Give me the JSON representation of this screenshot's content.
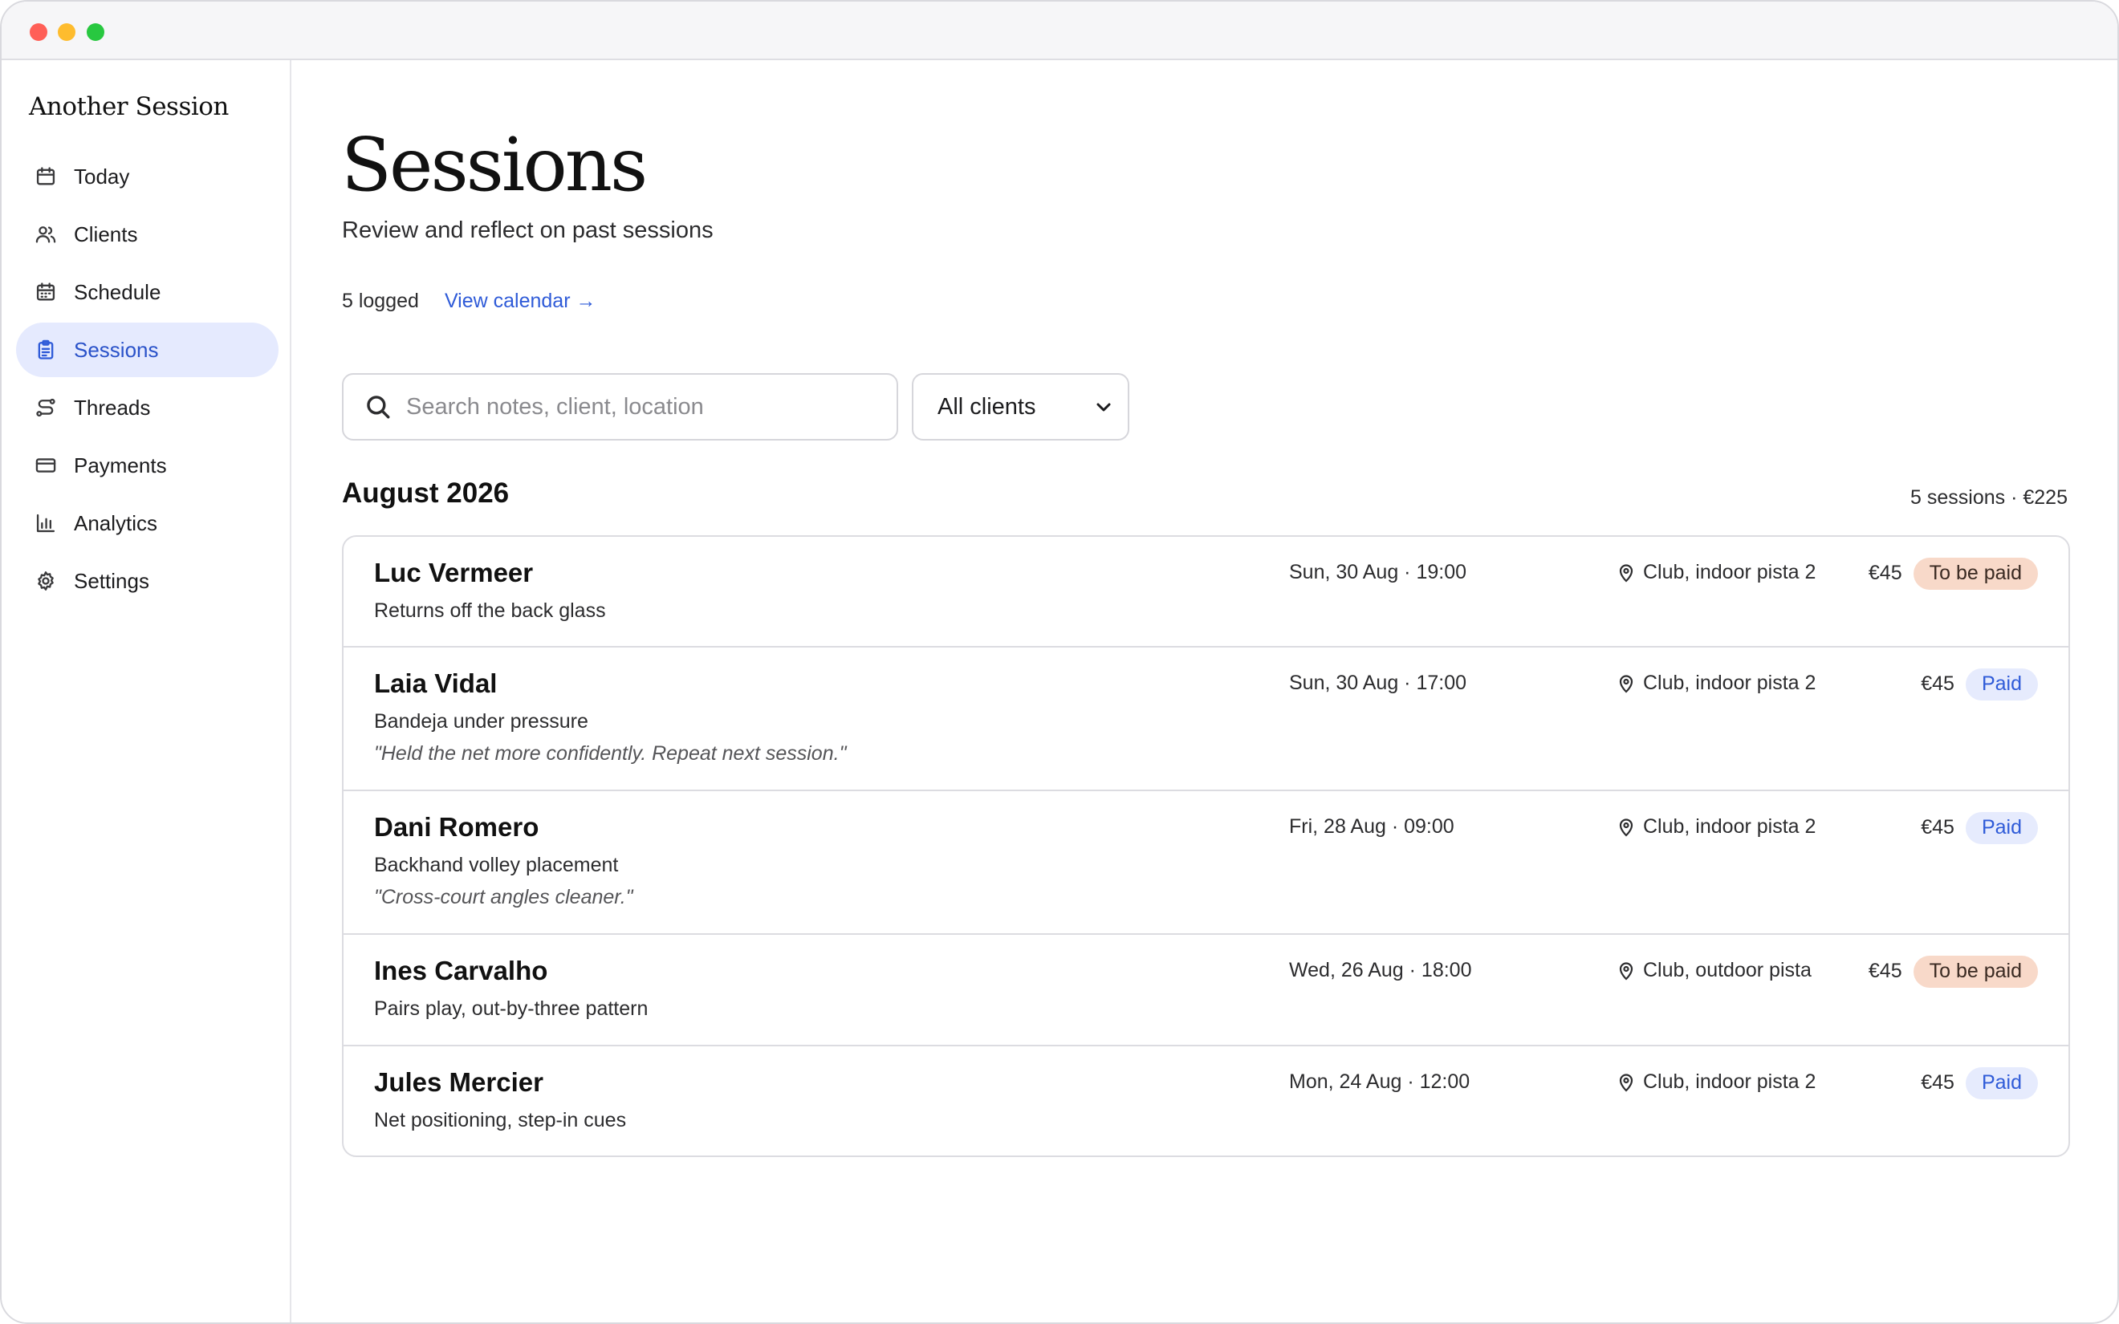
{
  "window": {
    "controls": [
      "close",
      "minimize",
      "zoom"
    ]
  },
  "sidebar": {
    "brand": "Another Session",
    "items": [
      {
        "label": "Today",
        "icon": "calendar-icon",
        "active": false
      },
      {
        "label": "Clients",
        "icon": "users-icon",
        "active": false
      },
      {
        "label": "Schedule",
        "icon": "calendar-grid-icon",
        "active": false
      },
      {
        "label": "Sessions",
        "icon": "clipboard-icon",
        "active": true
      },
      {
        "label": "Threads",
        "icon": "route-icon",
        "active": false
      },
      {
        "label": "Payments",
        "icon": "credit-card-icon",
        "active": false
      },
      {
        "label": "Analytics",
        "icon": "bar-chart-icon",
        "active": false
      },
      {
        "label": "Settings",
        "icon": "gear-icon",
        "active": false
      }
    ]
  },
  "header": {
    "title": "Sessions",
    "subtitle": "Review and reflect on past sessions",
    "count": "5 logged",
    "calendar_link": "View calendar →"
  },
  "filters": {
    "search_placeholder": "Search notes, client, location",
    "search_value": "",
    "client_filter": "All clients"
  },
  "month": {
    "title": "August 2026",
    "summary": "5 sessions · €225"
  },
  "colors": {
    "accent": "#2f5bd8",
    "active_nav_bg": "#e5eafe",
    "due_badge_bg": "#f8d9c9",
    "paid_badge_bg": "#e6ebfd"
  },
  "sessions": [
    {
      "client": "Luc Vermeer",
      "focus": "Returns off the back glass",
      "note": "",
      "when": "Sun, 30 Aug · 19:00",
      "where": "Club, indoor pista 2",
      "price": "€45",
      "status": "To be paid",
      "status_kind": "due"
    },
    {
      "client": "Laia Vidal",
      "focus": "Bandeja under pressure",
      "note": "\"Held the net more confidently. Repeat next session.\"",
      "when": "Sun, 30 Aug · 17:00",
      "where": "Club, indoor pista 2",
      "price": "€45",
      "status": "Paid",
      "status_kind": "paid"
    },
    {
      "client": "Dani Romero",
      "focus": "Backhand volley placement",
      "note": "\"Cross-court angles cleaner.\"",
      "when": "Fri, 28 Aug · 09:00",
      "where": "Club, indoor pista 2",
      "price": "€45",
      "status": "Paid",
      "status_kind": "paid"
    },
    {
      "client": "Ines Carvalho",
      "focus": "Pairs play, out-by-three pattern",
      "note": "",
      "when": "Wed, 26 Aug · 18:00",
      "where": "Club, outdoor pista",
      "price": "€45",
      "status": "To be paid",
      "status_kind": "due"
    },
    {
      "client": "Jules Mercier",
      "focus": "Net positioning, step-in cues",
      "note": "",
      "when": "Mon, 24 Aug · 12:00",
      "where": "Club, indoor pista 2",
      "price": "€45",
      "status": "Paid",
      "status_kind": "paid"
    }
  ]
}
